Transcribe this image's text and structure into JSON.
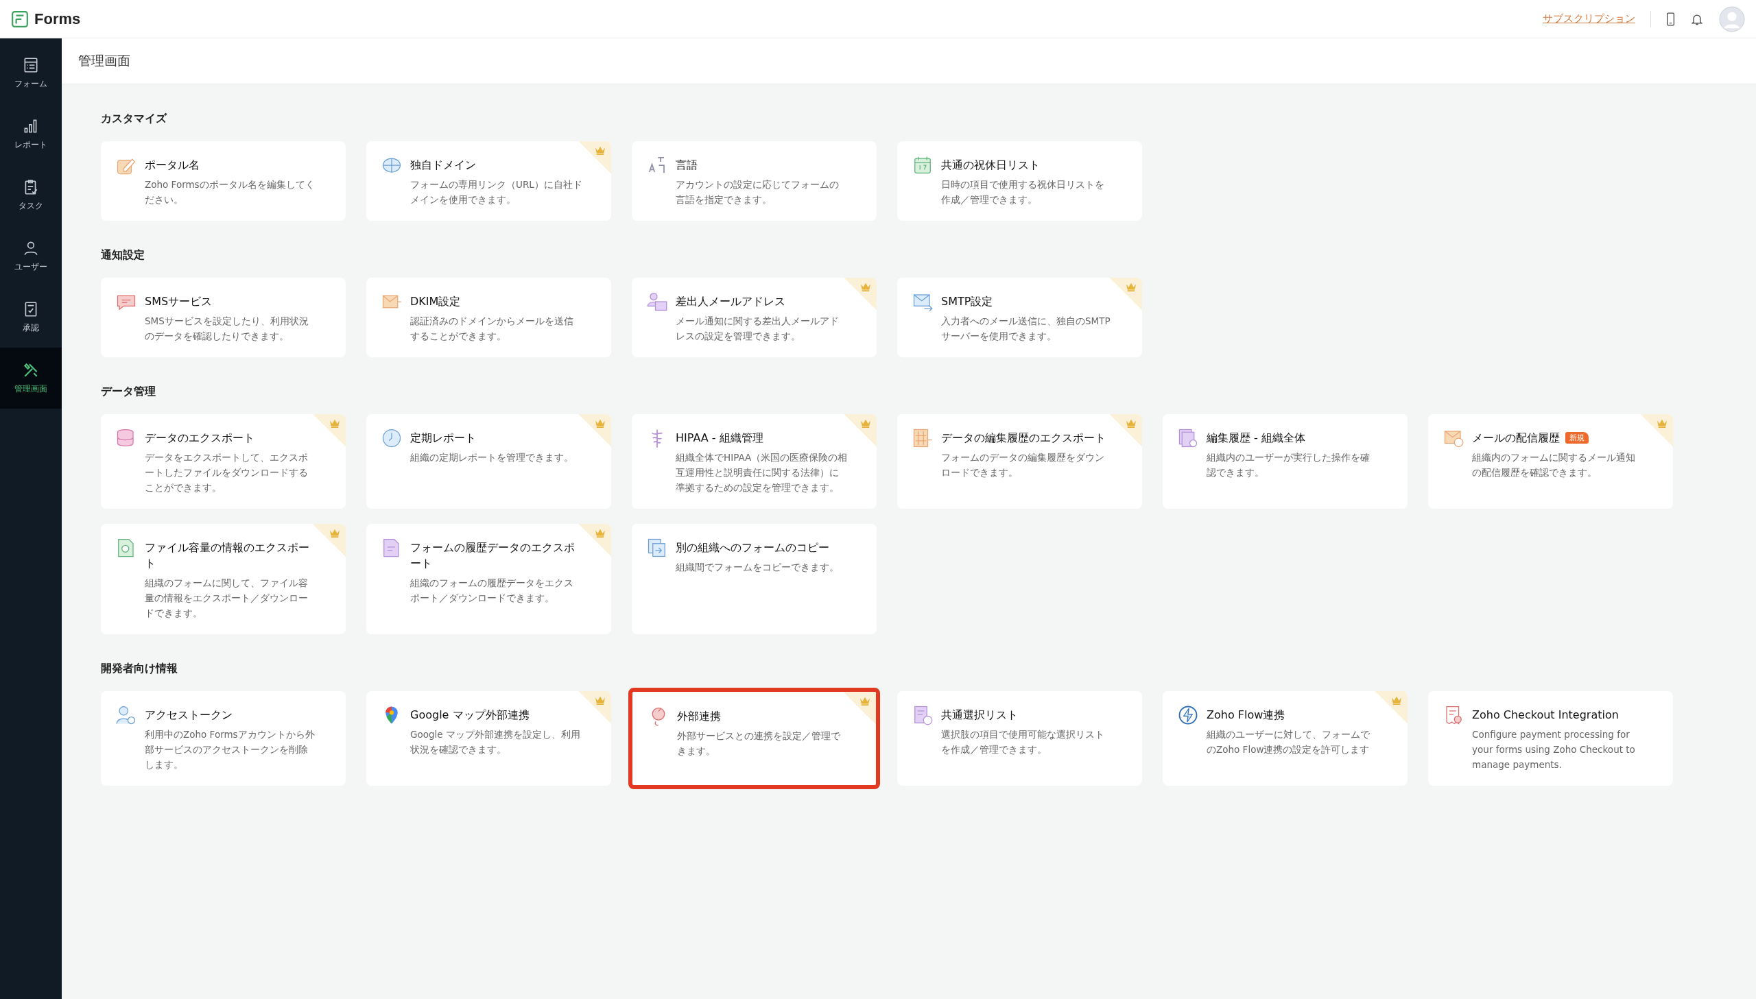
{
  "app": {
    "name": "Forms"
  },
  "topbar": {
    "subscription_link": "サブスクリプション"
  },
  "sidebar": {
    "items": [
      {
        "label": "フォーム",
        "selected": false
      },
      {
        "label": "レポート",
        "selected": false
      },
      {
        "label": "タスク",
        "selected": false
      },
      {
        "label": "ユーザー",
        "selected": false
      },
      {
        "label": "承認",
        "selected": false
      },
      {
        "label": "管理画面",
        "selected": true
      }
    ]
  },
  "page": {
    "title": "管理画面"
  },
  "sections": [
    {
      "title": "カスタマイズ",
      "cards": [
        {
          "title": "ポータル名",
          "description": "Zoho Formsのポータル名を編集してください。",
          "premium": false,
          "highlighted": false
        },
        {
          "title": "独自ドメイン",
          "description": "フォームの専用リンク（URL）に自社ドメインを使用できます。",
          "premium": true,
          "highlighted": false
        },
        {
          "title": "言語",
          "description": "アカウントの設定に応じてフォームの言語を指定できます。",
          "premium": false,
          "highlighted": false
        },
        {
          "title": "共通の祝休日リスト",
          "description": "日時の項目で使用する祝休日リストを作成／管理できます。",
          "premium": false,
          "highlighted": false
        }
      ]
    },
    {
      "title": "通知設定",
      "cards": [
        {
          "title": "SMSサービス",
          "description": "SMSサービスを設定したり、利用状況のデータを確認したりできます。",
          "premium": false,
          "highlighted": false
        },
        {
          "title": "DKIM設定",
          "description": "認証済みのドメインからメールを送信することができます。",
          "premium": false,
          "highlighted": false
        },
        {
          "title": "差出人メールアドレス",
          "description": "メール通知に関する差出人メールアドレスの設定を管理できます。",
          "premium": true,
          "highlighted": false
        },
        {
          "title": "SMTP設定",
          "description": "入力者へのメール送信に、独自のSMTPサーバーを使用できます。",
          "premium": true,
          "highlighted": false
        }
      ]
    },
    {
      "title": "データ管理",
      "cards": [
        {
          "title": "データのエクスポート",
          "description": "データをエクスポートして、エクスポートしたファイルをダウンロードすることができます。",
          "premium": true,
          "highlighted": false
        },
        {
          "title": "定期レポート",
          "description": "組織の定期レポートを管理できます。",
          "premium": true,
          "highlighted": false
        },
        {
          "title": "HIPAA - 組織管理",
          "description": "組織全体でHIPAA（米国の医療保険の相互運用性と説明責任に関する法律）に準拠するための設定を管理できます。",
          "premium": true,
          "highlighted": false
        },
        {
          "title": "データの編集履歴のエクスポート",
          "description": "フォームのデータの編集履歴をダウンロードできます。",
          "premium": true,
          "highlighted": false
        },
        {
          "title": "編集履歴 - 組織全体",
          "description": "組織内のユーザーが実行した操作を確認できます。",
          "premium": false,
          "highlighted": false
        },
        {
          "title": "メールの配信履歴",
          "badge": "新規",
          "description": "組織内のフォームに関するメール通知の配信履歴を確認できます。",
          "premium": true,
          "highlighted": false
        },
        {
          "title": "ファイル容量の情報のエクスポート",
          "description": "組織のフォームに関して、ファイル容量の情報をエクスポート／ダウンロードできます。",
          "premium": true,
          "highlighted": false
        },
        {
          "title": "フォームの履歴データのエクスポート",
          "description": "組織のフォームの履歴データをエクスポート／ダウンロードできます。",
          "premium": true,
          "highlighted": false
        },
        {
          "title": "別の組織へのフォームのコピー",
          "description": "組織間でフォームをコピーできます。",
          "premium": false,
          "highlighted": false
        }
      ]
    },
    {
      "title": "開発者向け情報",
      "cards": [
        {
          "title": "アクセストークン",
          "description": "利用中のZoho Formsアカウントから外部サービスのアクセストークンを削除します。",
          "premium": false,
          "highlighted": false
        },
        {
          "title": "Google マップ外部連携",
          "description": "Google マップ外部連携を設定し、利用状況を確認できます。",
          "premium": true,
          "highlighted": false
        },
        {
          "title": "外部連携",
          "description": "外部サービスとの連携を設定／管理できます。",
          "premium": true,
          "highlighted": true
        },
        {
          "title": "共通選択リスト",
          "description": "選択肢の項目で使用可能な選択リストを作成／管理できます。",
          "premium": false,
          "highlighted": false
        },
        {
          "title": "Zoho Flow連携",
          "description": "組織のユーザーに対して、フォームでのZoho Flow連携の設定を許可します",
          "premium": true,
          "highlighted": false
        },
        {
          "title": "Zoho Checkout Integration",
          "description": "Configure payment processing for your forms using Zoho Checkout to manage payments.",
          "premium": false,
          "highlighted": false
        }
      ]
    }
  ]
}
